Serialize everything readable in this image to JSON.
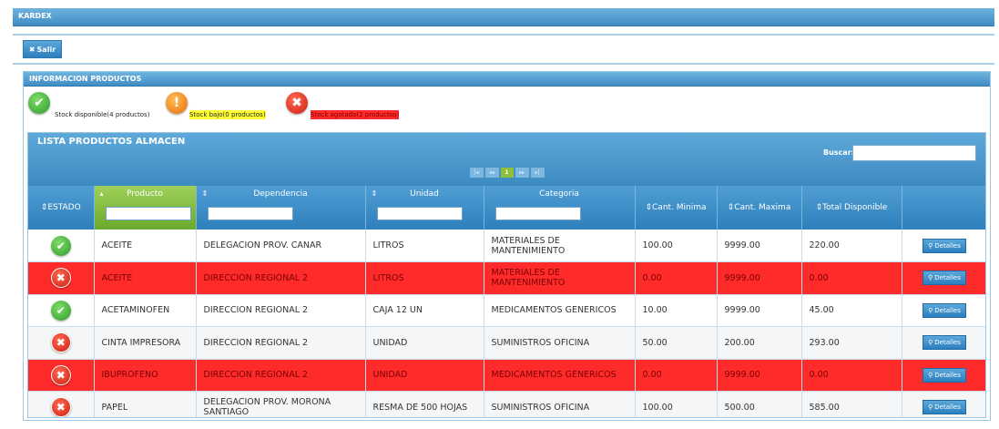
{
  "header": {
    "title": "KARDEX",
    "salir_label": "Salir"
  },
  "info": {
    "title": "INFORMACION PRODUCTOS",
    "legend": [
      {
        "label": "Stock disponible(4 productos)",
        "icon": "check-icon",
        "color": "#2f9a2a"
      },
      {
        "label": "Stock bajo(0 productos)",
        "icon": "exclamation-icon",
        "color": "#e86d0a",
        "bg": "#ffff33"
      },
      {
        "label": "Stock agotado(2 productos)",
        "icon": "x-icon",
        "color": "#cc1f10",
        "bg": "#ff2b2b"
      }
    ]
  },
  "list": {
    "title": "LISTA PRODUCTOS ALMACEN",
    "search_label": "Buscar:",
    "search_value": "",
    "pager": {
      "first": "|◂",
      "prev": "◂◂",
      "page": "1",
      "next": "▸▸",
      "last": "▸|"
    },
    "columns": [
      {
        "label": "ESTADO",
        "sort": "⇕"
      },
      {
        "label": "Producto",
        "sort": "▴"
      },
      {
        "label": "Dependencia",
        "sort": "⇕"
      },
      {
        "label": "Unidad",
        "sort": "⇕"
      },
      {
        "label": "Categoria",
        "sort": ""
      },
      {
        "label": "Cant. Minima",
        "sort": "⇕"
      },
      {
        "label": "Cant. Maxima",
        "sort": "⇕"
      },
      {
        "label": "Total Disponible",
        "sort": "⇕"
      }
    ],
    "details_label": "Detalles",
    "rows": [
      {
        "status": "ok",
        "producto": "ACEITE",
        "dependencia": "DELEGACION PROV. CANAR",
        "unidad": "LITROS",
        "categoria": "MATERIALES DE MANTENIMIENTO",
        "min": "100.00",
        "max": "9999.00",
        "total": "220.00"
      },
      {
        "status": "agotado",
        "producto": "ACEITE",
        "dependencia": "DIRECCION REGIONAL 2",
        "unidad": "LITROS",
        "categoria": "MATERIALES DE MANTENIMIENTO",
        "min": "0.00",
        "max": "9999.00",
        "total": "0.00"
      },
      {
        "status": "ok",
        "producto": "ACETAMINOFEN",
        "dependencia": "DIRECCION REGIONAL 2",
        "unidad": "CAJA 12 UN",
        "categoria": "MEDICAMENTOS GENERICOS",
        "min": "10.00",
        "max": "9999.00",
        "total": "45.00"
      },
      {
        "status": "x",
        "producto": "CINTA IMPRESORA",
        "dependencia": "DIRECCION REGIONAL 2",
        "unidad": "UNIDAD",
        "categoria": "SUMINISTROS OFICINA",
        "min": "50.00",
        "max": "200.00",
        "total": "293.00"
      },
      {
        "status": "agotado",
        "producto": "IBUPROFENO",
        "dependencia": "DIRECCION REGIONAL 2",
        "unidad": "UNIDAD",
        "categoria": "MEDICAMENTOS GENERICOS",
        "min": "0.00",
        "max": "9999.00",
        "total": "0.00"
      },
      {
        "status": "x",
        "producto": "PAPEL",
        "dependencia": "DELEGACION PROV. MORONA SANTIAGO",
        "unidad": "RESMA DE 500 HOJAS",
        "categoria": "SUMINISTROS OFICINA",
        "min": "100.00",
        "max": "500.00",
        "total": "585.00"
      }
    ]
  }
}
